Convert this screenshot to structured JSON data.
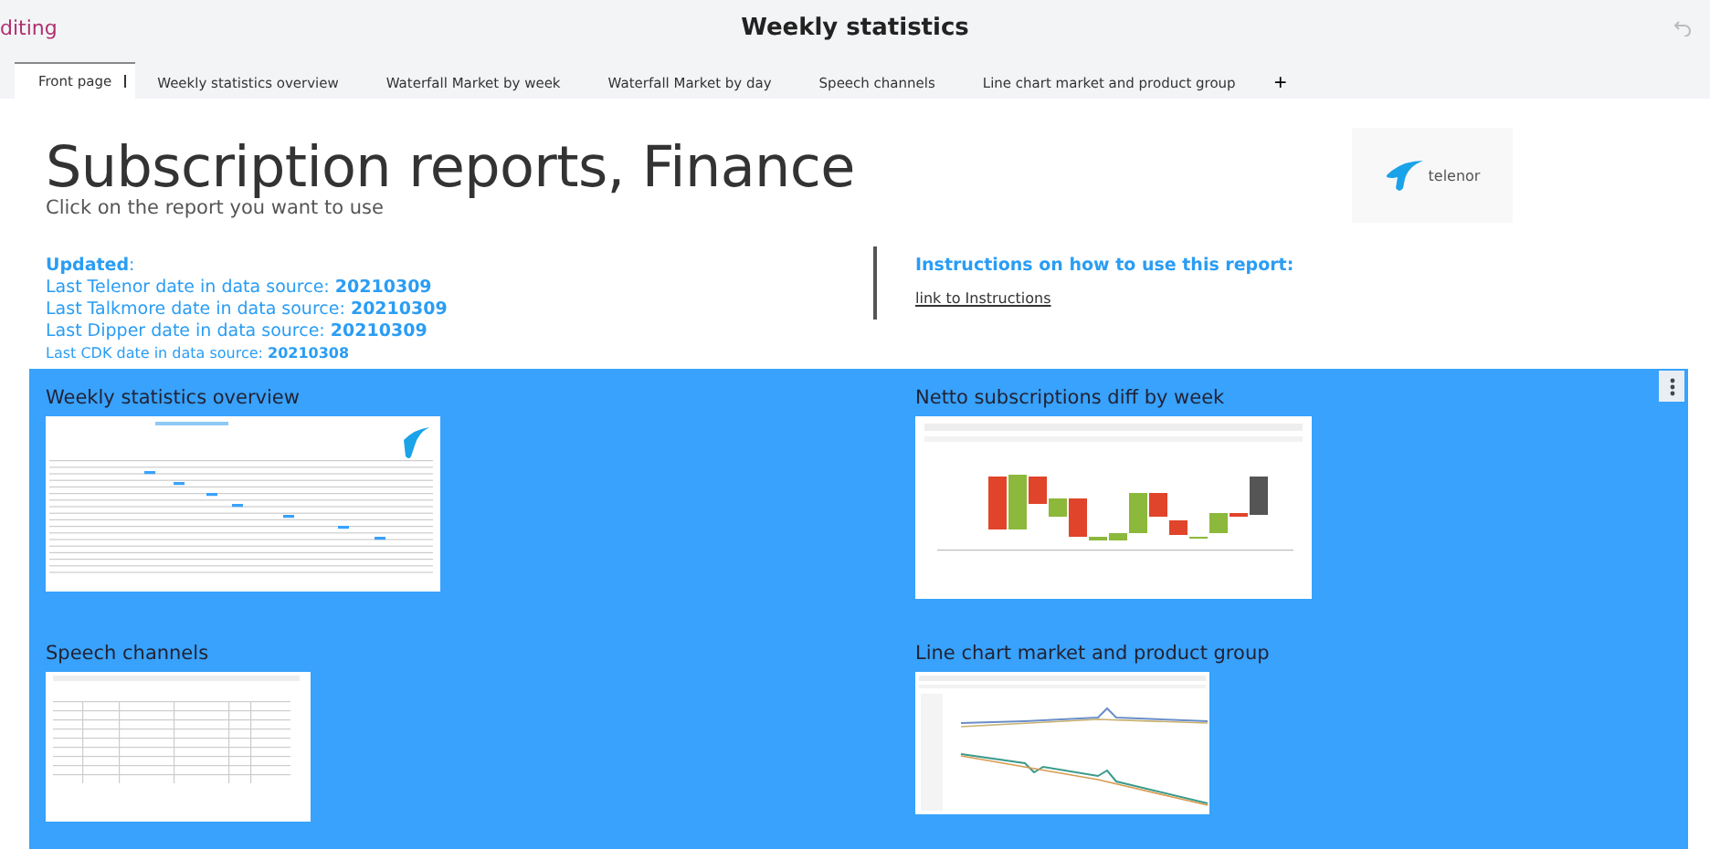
{
  "header": {
    "mode": "diting",
    "title": "Weekly statistics"
  },
  "tabs": [
    {
      "label": "Front page",
      "selected": true
    },
    {
      "label": "Weekly statistics overview",
      "selected": false
    },
    {
      "label": "Waterfall Market by week",
      "selected": false
    },
    {
      "label": "Waterfall Market by day",
      "selected": false
    },
    {
      "label": "Speech channels",
      "selected": false
    },
    {
      "label": "Line chart market and product group",
      "selected": false
    }
  ],
  "add_tab": "+",
  "page": {
    "title": "Subscription reports, Finance",
    "subtitle": "Click on the report you want to use",
    "logo_text": "telenor",
    "updated": {
      "heading": "**Updated**:",
      "lines": [
        {
          "label": "Last Telenor date in data source:",
          "value": "20210309"
        },
        {
          "label": "Last Talkmore date in data source:",
          "value": "20210309"
        },
        {
          "label": "Last Dipper date in data source:",
          "value": "20210309"
        },
        {
          "label": "Last CDK date in data source:",
          "value": "20210308"
        }
      ]
    },
    "instructions": {
      "heading": "Instructions on how to use this report:",
      "link": "link to Instructions"
    }
  },
  "reports": [
    {
      "title": "Weekly statistics overview",
      "kind": "table"
    },
    {
      "title": "Netto subscriptions diff by week",
      "kind": "waterfall"
    },
    {
      "title": "Speech channels",
      "kind": "small-table"
    },
    {
      "title": "Line chart market and product group",
      "kind": "line"
    }
  ]
}
